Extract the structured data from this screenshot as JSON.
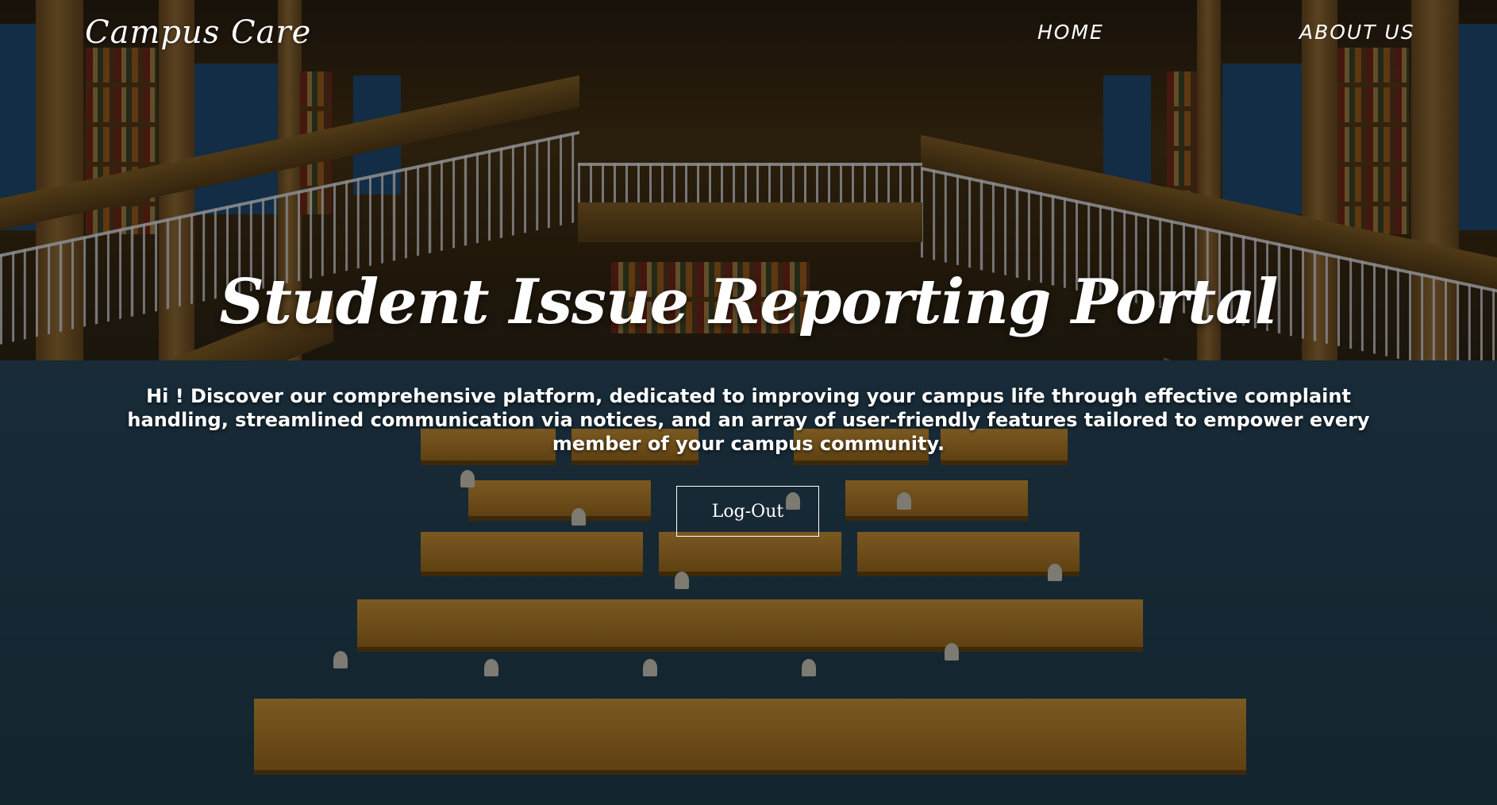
{
  "navbar": {
    "brand": "Campus Care",
    "links": [
      {
        "label": "HOME"
      },
      {
        "label": "ABOUT US"
      }
    ]
  },
  "hero": {
    "title": "Student Issue Reporting Portal",
    "description": "Hi ! Discover our comprehensive platform, dedicated to improving your campus life through effective complaint handling, streamlined communication via notices, and an array of user-friendly features tailored to empower every member of your campus community.",
    "logout_label": "Log-Out"
  },
  "background": {
    "image": "library-reading-room-photo"
  },
  "colors": {
    "text": "#ffffff",
    "overlay": "rgba(0,0,0,0.42)"
  }
}
